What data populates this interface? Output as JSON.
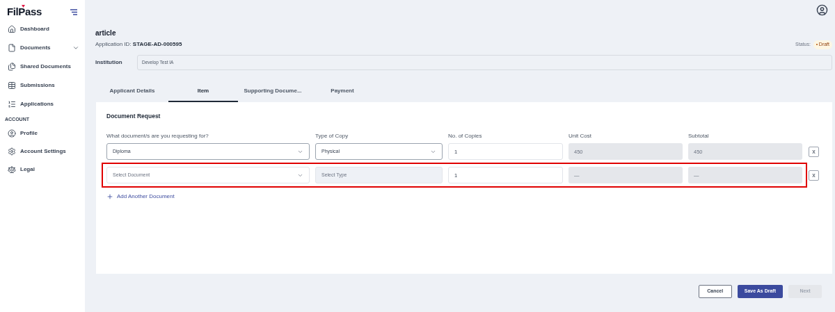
{
  "logo": "FilPass",
  "sidebar": {
    "items": [
      {
        "label": "Dashboard",
        "expandable": false,
        "selected": false
      },
      {
        "label": "Documents",
        "expandable": true,
        "selected": false
      },
      {
        "label": "Shared Documents",
        "expandable": false,
        "selected": false
      },
      {
        "label": "Submissions",
        "expandable": false,
        "selected": false
      },
      {
        "label": "Applications",
        "expandable": false,
        "selected": false
      }
    ],
    "section": "ACCOUNT",
    "account_items": [
      {
        "label": "Profile",
        "selected": false
      },
      {
        "label": "Account Settings",
        "selected": false
      },
      {
        "label": "Legal",
        "selected": false
      }
    ]
  },
  "title": "article",
  "application_id_label": "Application ID:",
  "application_id": "STAGE-AD-000595",
  "status_label": "Status:",
  "status": "Draft",
  "institution": {
    "label": "Institution",
    "value": "Develop Test IA"
  },
  "tabs": [
    {
      "label": "Applicant Details",
      "selected": false
    },
    {
      "label": "Item",
      "selected": true
    },
    {
      "label": "Supporting Docume...",
      "selected": false
    },
    {
      "label": "Payment",
      "selected": false
    }
  ],
  "section_title": "Document Request",
  "columns": [
    "What document/s are you requesting for?",
    "Type of Copy",
    "No. of Copies",
    "Unit Cost",
    "Subtotal"
  ],
  "rows": [
    {
      "document": {
        "value": "Diploma"
      },
      "type": {
        "value": "Physical",
        "disabled": false
      },
      "copies": "1",
      "unit_cost": "450",
      "subtotal": "450",
      "remove": "x",
      "highlighted": false
    },
    {
      "document": {
        "placeholder": "Select Document"
      },
      "type": {
        "placeholder": "Select Type",
        "disabled": true
      },
      "copies": "1",
      "unit_cost": "—",
      "subtotal": "—",
      "remove": "x",
      "highlighted": true
    }
  ],
  "add_label": "Add Another Document",
  "buttons": [
    {
      "label": "Cancel",
      "kind": "outline",
      "disabled": false
    },
    {
      "label": "Save As Draft",
      "kind": "primary",
      "disabled": false
    },
    {
      "label": "Next",
      "kind": "primary",
      "disabled": true
    }
  ]
}
